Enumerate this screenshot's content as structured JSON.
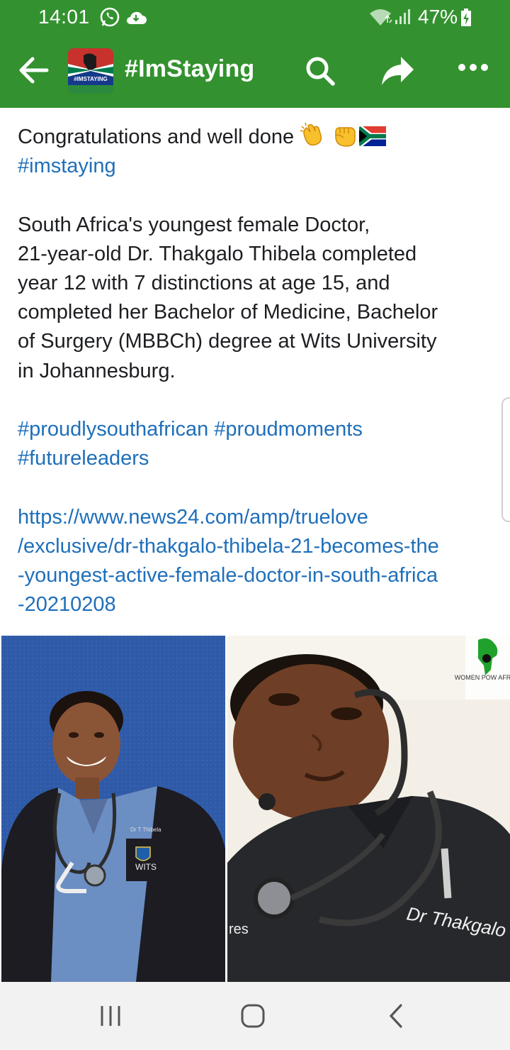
{
  "status_bar": {
    "time": "14:01",
    "battery": "47%",
    "icons": [
      "whatsapp-icon",
      "cloud-icon",
      "wifi-icon",
      "signal-icon",
      "battery-icon"
    ]
  },
  "header": {
    "title": "#ImStaying",
    "avatar_text": "#IMSTAYING",
    "background": "#33922f",
    "icons": [
      "back-arrow-icon",
      "search-icon",
      "share-icon",
      "more-icon"
    ]
  },
  "post": {
    "line1": "Congratulations and well done",
    "hashtag1": "#imstaying",
    "body_lines": [
      "South Africa's youngest female Doctor,",
      "21-year-old  Dr. Thakgalo Thibela completed",
      "year 12 with 7 distinctions at age 15, and",
      "completed her Bachelor of Medicine, Bachelor",
      "of Surgery (MBBCh) degree at Wits University",
      "in Johannesburg."
    ],
    "hashtags_line1": "#proudlysouthafrican #proudmoments",
    "hashtags_line2": "#futureleaders",
    "link_lines": [
      "https://www.news24.com/amp/truelove",
      "/exclusive/dr-thakgalo-thibela-21-becomes-the",
      "-youngest-active-female-doctor-in-south-africa",
      "-20210208"
    ],
    "link_color": "#1f6fba",
    "emojis": [
      "clapping-hands-emoji",
      "raised-fist-emoji",
      "south-africa-flag-emoji"
    ]
  },
  "photos": {
    "left": {
      "badge_text": "Dr T Thibela",
      "crest_text": "WITS"
    },
    "right": {
      "embroidery": "Dr Thakgalo Th",
      "overlay_logo": "WOMEN POW AFRICA",
      "side_text": "res"
    }
  },
  "system_nav": {
    "buttons": [
      "recent-apps-button",
      "home-button",
      "back-button"
    ]
  }
}
